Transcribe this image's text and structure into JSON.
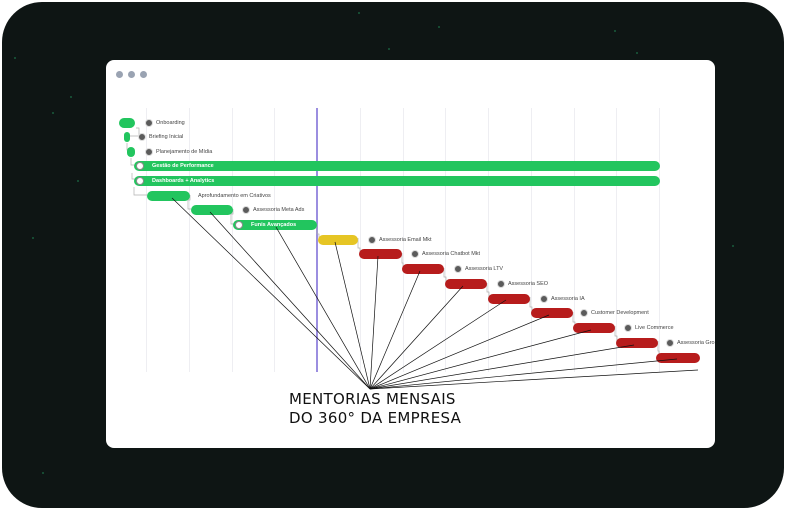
{
  "window": {
    "controls": [
      "window-dot",
      "window-dot",
      "window-dot"
    ]
  },
  "tasks": [
    {
      "id": "onboarding",
      "label": "Onboarding",
      "status": "done",
      "color": "#22c55e"
    },
    {
      "id": "briefing",
      "label": "Briefing Inicial",
      "status": "done",
      "color": "#22c55e"
    },
    {
      "id": "planejamento",
      "label": "Planejamento de Mídia",
      "status": "done",
      "color": "#22c55e"
    },
    {
      "id": "gestao",
      "label": "Gestão de Performance",
      "status": "done",
      "color": "#22c55e"
    },
    {
      "id": "dashboards",
      "label": "Dashboards + Analytics",
      "status": "done",
      "color": "#22c55e"
    },
    {
      "id": "aprofundamento",
      "label": "Aprofundamento em Criativos",
      "status": "done",
      "color": "#22c55e"
    },
    {
      "id": "meta",
      "label": "Assessoria Meta Ads",
      "status": "done",
      "color": "#22c55e"
    },
    {
      "id": "funis",
      "label": "Funis Avançados",
      "status": "done",
      "color": "#22c55e"
    },
    {
      "id": "email",
      "label": "Assessoria Email Mkt",
      "status": "in-progress",
      "color": "#e6c524"
    },
    {
      "id": "chatbot",
      "label": "Assessoria Chatbot Mkt",
      "status": "pending",
      "color": "#b71c1c"
    },
    {
      "id": "ltv",
      "label": "Assessoria LTV",
      "status": "pending",
      "color": "#b71c1c"
    },
    {
      "id": "seo",
      "label": "Assessoria SEO",
      "status": "pending",
      "color": "#b71c1c"
    },
    {
      "id": "ia",
      "label": "Assessoria IA",
      "status": "pending",
      "color": "#b71c1c"
    },
    {
      "id": "customer",
      "label": "Customer Development",
      "status": "pending",
      "color": "#b71c1c"
    },
    {
      "id": "live",
      "label": "Live Commerce",
      "status": "pending",
      "color": "#b71c1c"
    },
    {
      "id": "gro",
      "label": "Assessoria Gro",
      "status": "pending",
      "color": "#b71c1c"
    }
  ],
  "annotation": {
    "line1": "MENTORIAS MENSAIS",
    "line2": "DO 360° DA EMPRESA"
  },
  "colors": {
    "frame": "#0e1514",
    "done": "#22c55e",
    "in_progress": "#e6c524",
    "pending": "#b71c1c",
    "today_marker": "#9b8ee0"
  }
}
